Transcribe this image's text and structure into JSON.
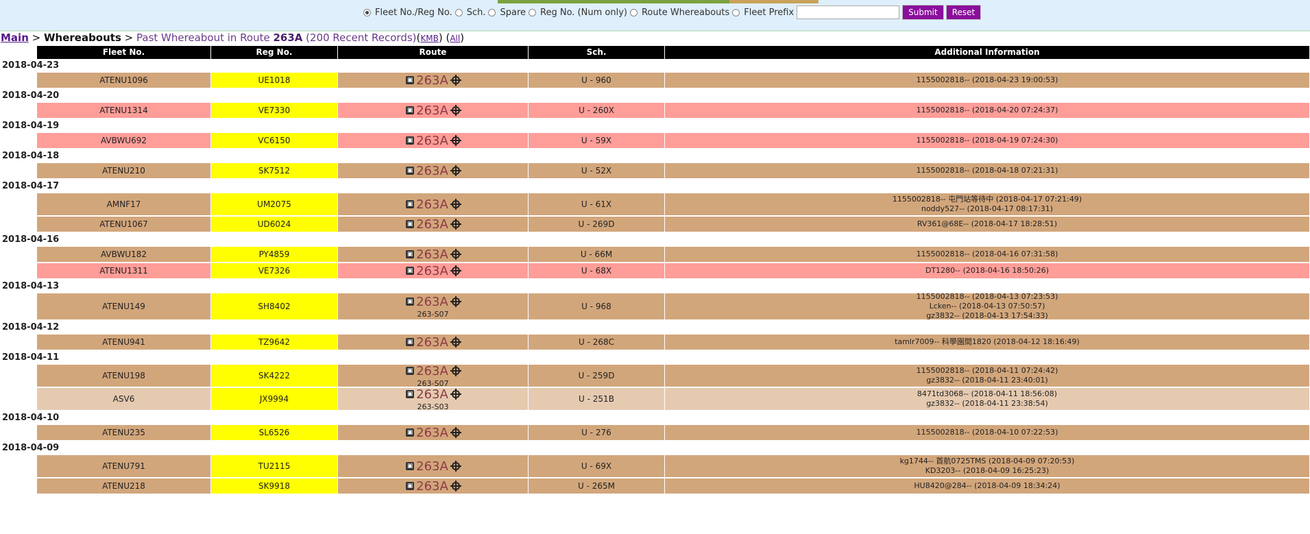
{
  "search": {
    "options": [
      {
        "label": "Fleet No./Reg No.",
        "selected": true
      },
      {
        "label": "Sch.",
        "selected": false
      },
      {
        "label": "Spare",
        "selected": false
      },
      {
        "label": "Reg No. (Num only)",
        "selected": false
      },
      {
        "label": "Route Whereabouts",
        "selected": false
      },
      {
        "label": "Fleet Prefix",
        "selected": false
      }
    ],
    "input_value": "",
    "submit_label": "Submit",
    "reset_label": "Reset"
  },
  "breadcrumb": {
    "main": "Main",
    "sep1": " > ",
    "current": "Whereabouts",
    "sep2": " > ",
    "title_prefix": "Past Whereabout in Route ",
    "route": "263A",
    "title_suffix": " (200 Recent Records)",
    "link_kmb": "KMB",
    "link_all": "All"
  },
  "table": {
    "headers": [
      "Fleet No.",
      "Reg No.",
      "Route",
      "Sch.",
      "Additional Information"
    ],
    "groups": [
      {
        "date": "2018-04-23",
        "rows": [
          {
            "fleet": "ATENU1096",
            "reg": "UE1018",
            "route": "263A",
            "route_sub": "",
            "sch": "U - 960",
            "info": [
              "1155002818-- (2018-04-23 19:00:53)"
            ],
            "bg": "tan"
          }
        ]
      },
      {
        "date": "2018-04-20",
        "rows": [
          {
            "fleet": "ATENU1314",
            "reg": "VE7330",
            "route": "263A",
            "route_sub": "",
            "sch": "U - 260X",
            "info": [
              "1155002818-- (2018-04-20 07:24:37)"
            ],
            "bg": "pink"
          }
        ]
      },
      {
        "date": "2018-04-19",
        "rows": [
          {
            "fleet": "AVBWU692",
            "reg": "VC6150",
            "route": "263A",
            "route_sub": "",
            "sch": "U - 59X",
            "info": [
              "1155002818-- (2018-04-19 07:24:30)"
            ],
            "bg": "pink"
          }
        ]
      },
      {
        "date": "2018-04-18",
        "rows": [
          {
            "fleet": "ATENU210",
            "reg": "SK7512",
            "route": "263A",
            "route_sub": "",
            "sch": "U - 52X",
            "info": [
              "1155002818-- (2018-04-18 07:21:31)"
            ],
            "bg": "tan"
          }
        ]
      },
      {
        "date": "2018-04-17",
        "rows": [
          {
            "fleet": "AMNF17",
            "reg": "UM2075",
            "route": "263A",
            "route_sub": "",
            "sch": "U - 61X",
            "info": [
              "1155002818-- 屯門站等待中 (2018-04-17 07:21:49)",
              "noddy527-- (2018-04-17 08:17:31)"
            ],
            "bg": "tan"
          },
          {
            "fleet": "ATENU1067",
            "reg": "UD6024",
            "route": "263A",
            "route_sub": "",
            "sch": "U - 269D",
            "info": [
              "RV361@68E-- (2018-04-17 18:28:51)"
            ],
            "bg": "tan"
          }
        ]
      },
      {
        "date": "2018-04-16",
        "rows": [
          {
            "fleet": "AVBWU182",
            "reg": "PY4859",
            "route": "263A",
            "route_sub": "",
            "sch": "U - 66M",
            "info": [
              "1155002818-- (2018-04-16 07:31:58)"
            ],
            "bg": "tan"
          },
          {
            "fleet": "ATENU1311",
            "reg": "VE7326",
            "route": "263A",
            "route_sub": "",
            "sch": "U - 68X",
            "info": [
              "DT1280-- (2018-04-16 18:50:26)"
            ],
            "bg": "pink"
          }
        ]
      },
      {
        "date": "2018-04-13",
        "rows": [
          {
            "fleet": "ATENU149",
            "reg": "SH8402",
            "route": "263A",
            "route_sub": "263-S07",
            "sch": "U - 968",
            "info": [
              "1155002818-- (2018-04-13 07:23:53)",
              "Lcken-- (2018-04-13 07:50:57)",
              "gz3832-- (2018-04-13 17:54:33)"
            ],
            "bg": "tan"
          }
        ]
      },
      {
        "date": "2018-04-12",
        "rows": [
          {
            "fleet": "ATENU941",
            "reg": "TZ9642",
            "route": "263A",
            "route_sub": "",
            "sch": "U - 268C",
            "info": [
              "tamlr7009-- 科學園間1820 (2018-04-12 18:16:49)"
            ],
            "bg": "tan"
          }
        ]
      },
      {
        "date": "2018-04-11",
        "rows": [
          {
            "fleet": "ATENU198",
            "reg": "SK4222",
            "route": "263A",
            "route_sub": "263-S07",
            "sch": "U - 259D",
            "info": [
              "1155002818-- (2018-04-11 07:24:42)",
              "gz3832-- (2018-04-11 23:40:01)"
            ],
            "bg": "tan"
          },
          {
            "fleet": "ASV6",
            "reg": "JX9994",
            "route": "263A",
            "route_sub": "263-S03",
            "sch": "U - 251B",
            "info": [
              "8471td3068-- (2018-04-11 18:56:08)",
              "gz3832-- (2018-04-11 23:38:54)"
            ],
            "bg": "light"
          }
        ]
      },
      {
        "date": "2018-04-10",
        "rows": [
          {
            "fleet": "ATENU235",
            "reg": "SL6526",
            "route": "263A",
            "route_sub": "",
            "sch": "U - 276",
            "info": [
              "1155002818-- (2018-04-10 07:22:53)"
            ],
            "bg": "tan"
          }
        ]
      },
      {
        "date": "2018-04-09",
        "rows": [
          {
            "fleet": "ATENU791",
            "reg": "TU2115",
            "route": "263A",
            "route_sub": "",
            "sch": "U - 69X",
            "info": [
              "kg1744-- 首航0725TMS (2018-04-09 07:20:53)",
              "KD3203-- (2018-04-09 16:25:23)"
            ],
            "bg": "tan"
          },
          {
            "fleet": "ATENU218",
            "reg": "SK9918",
            "route": "263A",
            "route_sub": "",
            "sch": "U - 265M",
            "info": [
              "HU8420@284-- (2018-04-09 18:34:24)"
            ],
            "bg": "tan"
          }
        ]
      }
    ]
  },
  "colors": {
    "tan": "#d2a67b",
    "pink": "#ff9d98",
    "light": "#e5cab0",
    "reg": "#ffff00",
    "button": "#8a0f9b"
  },
  "icons": {
    "route_left": "bus-stop-icon",
    "route_right": "crosshair-icon"
  }
}
